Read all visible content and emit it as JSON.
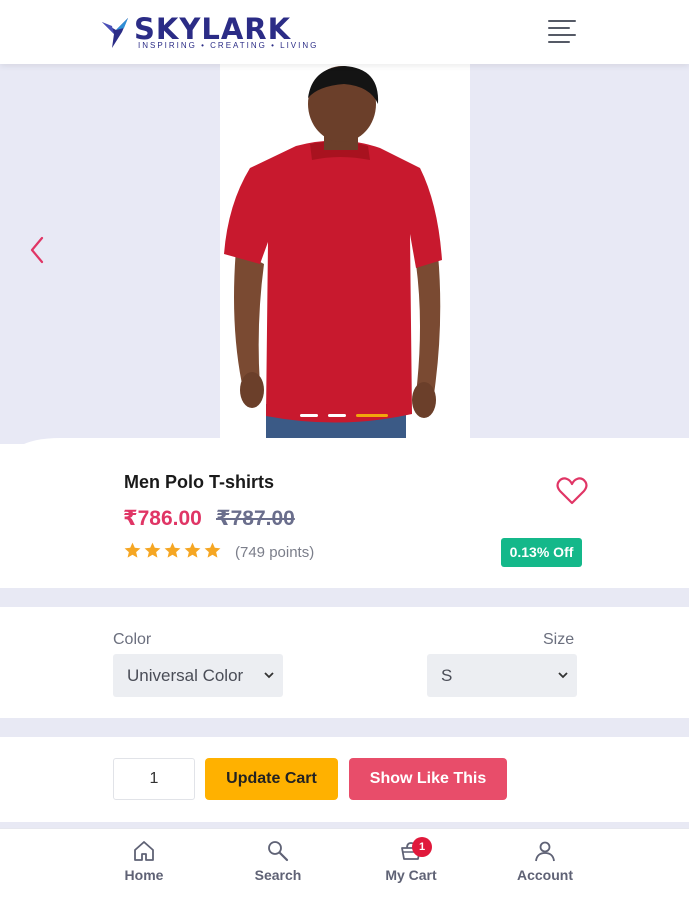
{
  "header": {
    "logo_text": "SKYLARK",
    "logo_tagline": "INSPIRING  •  CREATING  •  LIVING",
    "menu_icon": "hamburger-menu-icon",
    "brand_color": "#2b2c86"
  },
  "gallery": {
    "prev_icon": "chevron-left-icon",
    "slide_count": 3,
    "active_slide": 3,
    "accent_color": "#e03565"
  },
  "product": {
    "title": "Men Polo T-shirts",
    "price": "₹786.00",
    "mrp": "₹787.00",
    "rating_stars": 5,
    "rating_text": "(749 points)",
    "discount_badge": "0.13% Off",
    "wishlist_icon": "heart-outline-icon",
    "discount_color": "#14b88a",
    "price_color": "#e03565"
  },
  "options": {
    "color_label": "Color",
    "color_value": "Universal Color",
    "size_label": "Size",
    "size_value": "S"
  },
  "actions": {
    "quantity": "1",
    "update_cart_label": "Update Cart",
    "show_like_this_label": "Show Like This",
    "update_color": "#ffb100",
    "show_color": "#e84d6a"
  },
  "bottom_nav": {
    "items": [
      {
        "label": "Home",
        "icon": "home-icon"
      },
      {
        "label": "Search",
        "icon": "search-icon"
      },
      {
        "label": "My Cart",
        "icon": "cart-icon",
        "badge": "1"
      },
      {
        "label": "Account",
        "icon": "user-icon"
      }
    ]
  }
}
